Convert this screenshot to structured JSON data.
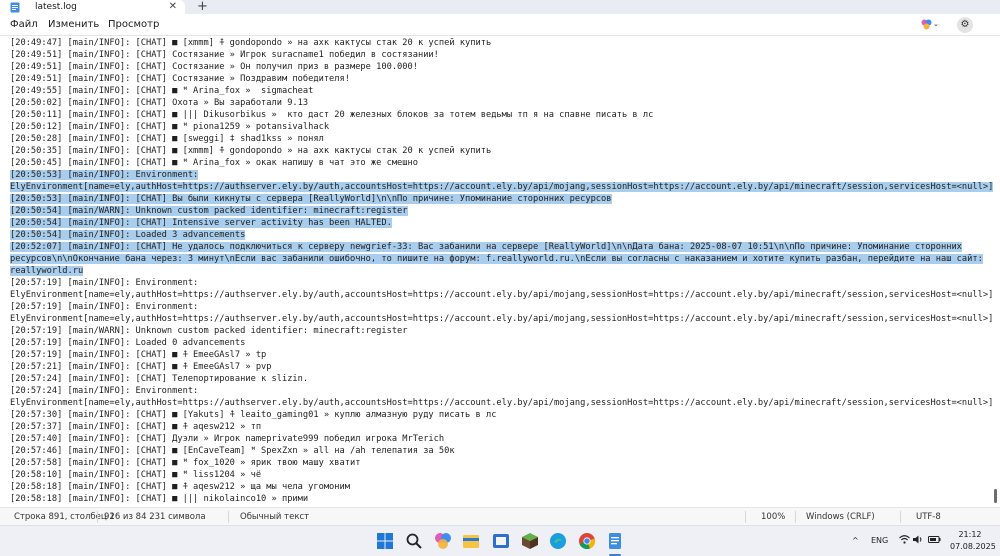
{
  "window": {
    "tab_title": "latest.log",
    "new_tab_symbol": "+",
    "close_symbol": "✕",
    "minimize_symbol": "—",
    "maximize_symbol": "☐",
    "file_icon": "notepad-file-icon"
  },
  "menu": {
    "file": "Файл",
    "edit": "Изменить",
    "view": "Просмотр"
  },
  "lines": [
    {
      "text": "[20:49:47] [main/INFO]: [CHAT] ■ [xmmm] ⍏ gondopondo » на ахк кактусы стак 20 к успей купить",
      "selected": false
    },
    {
      "text": "[20:49:51] [main/INFO]: [CHAT] Состязание » Игрок suracname1 победил в состязании!",
      "selected": false
    },
    {
      "text": "[20:49:51] [main/INFO]: [CHAT] Состязание » Он получил приз в размере 100.000!",
      "selected": false
    },
    {
      "text": "[20:49:51] [main/INFO]: [CHAT] Состязание » Поздравим победителя!",
      "selected": false
    },
    {
      "text": "[20:49:55] [main/INFO]: [CHAT] ■ ꟸ Arina_fox »  sigmacheat",
      "selected": false
    },
    {
      "text": "[20:50:02] [main/INFO]: [CHAT] Охота » Вы заработали 9.13",
      "selected": false
    },
    {
      "text": "[20:50:11] [main/INFO]: [CHAT] ■ ||| Dikusorbikus »  кто даст 20 железных блоков за тотем ведьмы тп я на спавне писать в лс",
      "selected": false
    },
    {
      "text": "[20:50:12] [main/INFO]: [CHAT] ■ ꟸ piona1259 » potansivalhack",
      "selected": false
    },
    {
      "text": "[20:50:28] [main/INFO]: [CHAT] ■ [sweggi] ‡ shad1kss » понял",
      "selected": false
    },
    {
      "text": "[20:50:35] [main/INFO]: [CHAT] ■ [xmmm] ⍏ gondopondo » на ахк кактусы стак 20 к успей купить",
      "selected": false
    },
    {
      "text": "[20:50:45] [main/INFO]: [CHAT] ■ ꟸ Arina_fox » окак напишу в чат это же смешно",
      "selected": false
    },
    {
      "text": "[20:50:53] [main/INFO]: Environment:",
      "selected": true
    },
    {
      "text": "ElyEnvironment[name=ely,authHost=https://authserver.ely.by/auth,accountsHost=https://account.ely.by/api/mojang,sessionHost=https://account.ely.by/api/minecraft/session,servicesHost=<null>]",
      "selected": true
    },
    {
      "text": "[20:50:53] [main/INFO]: [CHAT] Вы были кикнуты с сервера [ReallyWorld]\\n\\nПо причине: Упоминание сторонних ресурсов",
      "selected": true
    },
    {
      "text": "[20:50:54] [main/WARN]: Unknown custom packed identifier: minecraft:register",
      "selected": true
    },
    {
      "text": "[20:50:54] [main/INFO]: [CHAT] Intensive server activity has been HALTED.",
      "selected": true
    },
    {
      "text": "[20:50:54] [main/INFO]: Loaded 3 advancements",
      "selected": true
    },
    {
      "text": "[20:52:07] [main/INFO]: [CHAT] Не удалось подключиться к серверу newgrief-33: Вас забанили на сервере [ReallyWorld]\\n\\nДата бана: 2025-08-07 10:51\\n\\nПо причине: Упоминание сторонних",
      "selected": true
    },
    {
      "text": "ресурсов\\n\\nОкончание бана через: 3 минут\\nЕсли вас забанили ошибочно, то пишите на форум: f.reallyworld.ru.\\nЕсли вы согласны с наказанием и хотите купить разбан, перейдите на наш сайт:",
      "selected": true
    },
    {
      "text": "reallyworld.ru",
      "selected": true
    },
    {
      "text": "[20:57:19] [main/INFO]: Environment:",
      "selected": false
    },
    {
      "text": "ElyEnvironment[name=ely,authHost=https://authserver.ely.by/auth,accountsHost=https://account.ely.by/api/mojang,sessionHost=https://account.ely.by/api/minecraft/session,servicesHost=<null>]",
      "selected": false
    },
    {
      "text": "[20:57:19] [main/INFO]: Environment:",
      "selected": false
    },
    {
      "text": "ElyEnvironment[name=ely,authHost=https://authserver.ely.by/auth,accountsHost=https://account.ely.by/api/mojang,sessionHost=https://account.ely.by/api/minecraft/session,servicesHost=<null>]",
      "selected": false
    },
    {
      "text": "[20:57:19] [main/WARN]: Unknown custom packed identifier: minecraft:register",
      "selected": false
    },
    {
      "text": "[20:57:19] [main/INFO]: Loaded 0 advancements",
      "selected": false
    },
    {
      "text": "[20:57:19] [main/INFO]: [CHAT] ■ ⍏ EmeeGAsl7 » tp",
      "selected": false
    },
    {
      "text": "[20:57:21] [main/INFO]: [CHAT] ■ ⍏ EmeeGAsl7 » pvp",
      "selected": false
    },
    {
      "text": "[20:57:24] [main/INFO]: [CHAT] Телепортирование к slizin.",
      "selected": false
    },
    {
      "text": "[20:57:24] [main/INFO]: Environment:",
      "selected": false
    },
    {
      "text": "ElyEnvironment[name=ely,authHost=https://authserver.ely.by/auth,accountsHost=https://account.ely.by/api/mojang,sessionHost=https://account.ely.by/api/minecraft/session,servicesHost=<null>]",
      "selected": false
    },
    {
      "text": "[20:57:30] [main/INFO]: [CHAT] ■ [Yakuts] ⍏ leaito_gaming01 » куплю алмазную руду писать в лс",
      "selected": false
    },
    {
      "text": "[20:57:37] [main/INFO]: [CHAT] ■ ⍏ aqesw212 » тп",
      "selected": false
    },
    {
      "text": "[20:57:40] [main/INFO]: [CHAT] Дуэли » Игрок nameprivate999 победил игрока MrTerich",
      "selected": false
    },
    {
      "text": "[20:57:46] [main/INFO]: [CHAT] ■ [EnCaveTeam] ꟸ SpexZxn » all на /ah телепатия за 50к",
      "selected": false
    },
    {
      "text": "[20:57:58] [main/INFO]: [CHAT] ■ ꟸ fox_1020 » ярик твою машу хватит",
      "selected": false
    },
    {
      "text": "[20:58:10] [main/INFO]: [CHAT] ■ ꟸ liss1204 » чё",
      "selected": false
    },
    {
      "text": "[20:58:18] [main/INFO]: [CHAT] ■ ⍏ aqesw212 » ща мы чела угомоним",
      "selected": false
    },
    {
      "text": "[20:58:18] [main/INFO]: [CHAT] ■ ||| nikolainco10 » прими",
      "selected": false
    }
  ],
  "status": {
    "position": "Строка 891, столбец 1",
    "selection": "926 из 84 231 символа",
    "format": "Обычный текст",
    "zoom": "100%",
    "line_endings": "Windows (CRLF)",
    "encoding": "UTF-8"
  },
  "taskbar": {
    "language": "ENG",
    "tray_chevron": "^",
    "time": "21:12",
    "date": "07.08.2025",
    "icons": [
      "windows-start-icon",
      "search-icon",
      "copilot-icon",
      "file-explorer-icon",
      "media-app-icon",
      "minecraft-icon",
      "edge-icon",
      "chrome-icon",
      "notepad-icon"
    ]
  },
  "colors": {
    "selection": "#a9cdec",
    "accent": "#3b7fd6"
  }
}
